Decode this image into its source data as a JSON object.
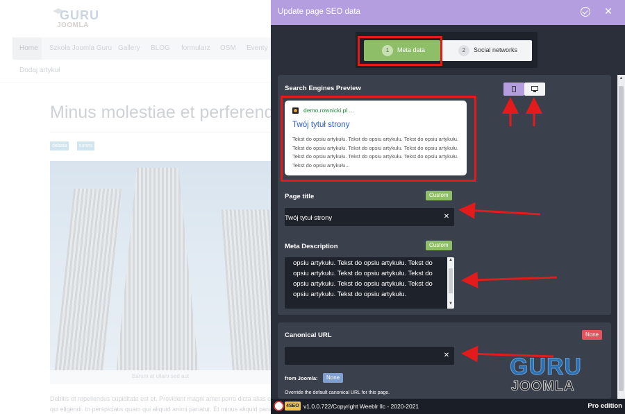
{
  "site": {
    "logo_top": "GURU",
    "logo_bottom": "JOOMLA",
    "nav": [
      "Home",
      "Szkoła Joomla Guru",
      "Gallery",
      "BLOG",
      "formularz",
      "OSM",
      "Eventy"
    ],
    "nav_second_row": "Dodaj artykuł",
    "article_title": "Minus molestiae et perferendis",
    "tags": [
      "debata",
      "tumes"
    ],
    "image_caption": "Earum at ullam sed aut",
    "body_text_line1": "Debitis et repellendus cupiditate est et. Provident magni amet porro dicta alias officia",
    "body_text_line2": "qui eligendi. In perspiciatis quam qui aliquid animi pariatur. Et minus aliquid pariatur"
  },
  "panel": {
    "title": "Update page SEO data",
    "steps": [
      {
        "num": "1",
        "label": "Meta data"
      },
      {
        "num": "2",
        "label": "Social networks"
      }
    ],
    "serp_section_label": "Search Engines Preview",
    "serp": {
      "url": "demo.rownicki.pl ...",
      "title": "Twój tytuł strony",
      "description": "Tekst do opsiu artykułu. Tekst do opsiu artykułu. Tekst do opsiu artykułu. Tekst do opsiu artykułu. Tekst do opsiu artykułu. Tekst do opsiu artykułu. Tekst do opsiu artykułu. Tekst do opsiu artykułu. Tekst do opsiu artykułu. Tekst do opsiu artykułu..."
    },
    "page_title": {
      "label": "Page title",
      "badge": "Custom",
      "value": "Twój tytuł strony"
    },
    "meta_description": {
      "label": "Meta Description",
      "badge": "Custom",
      "value": "opsiu artykułu. Tekst do opsiu artykułu. Tekst do opsiu artykułu. Tekst do opsiu artykułu. Tekst do opsiu artykułu. Tekst do opsiu artykułu. Tekst do opsiu artykułu. Tekst do opsiu artykułu."
    },
    "canonical": {
      "label": "Canonical URL",
      "badge": "None",
      "value": "",
      "from_joomla_label": "from Joomla:",
      "from_joomla_badge": "None",
      "override_text": "Override the default canonical URL for this page."
    },
    "watermark": {
      "top": "GURU",
      "bottom": "JOOMLA"
    },
    "footer": {
      "logo_word": "4SEO",
      "version": "v1.0.0.722/Copyright Weeblr llc - 2020-2021",
      "edition": "Pro edition"
    }
  },
  "colors": {
    "header": "#b49ee0",
    "panel_bg": "#2a2f3a",
    "card_bg": "#3a404c",
    "step_active": "#8fbe69",
    "badge_custom": "#8fbe69",
    "badge_none": "#e2535d",
    "annotation": "#e41b1b"
  }
}
